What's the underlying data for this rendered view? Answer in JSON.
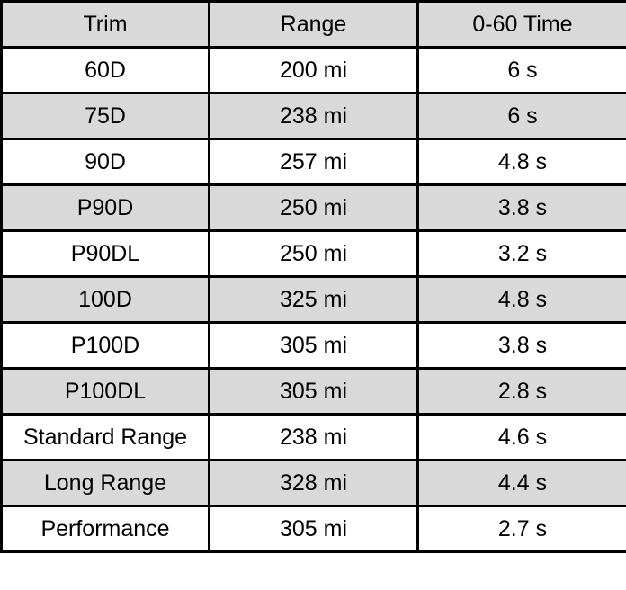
{
  "table": {
    "headers": [
      "Trim",
      "Range",
      "0-60 Time"
    ],
    "header_bg": "#d9d9d9",
    "shade_bg": "#d9d9d9",
    "rows": [
      {
        "trim": "60D",
        "range": "200 mi",
        "zero_to_sixty": "6 s",
        "shaded": false
      },
      {
        "trim": "75D",
        "range": "238 mi",
        "zero_to_sixty": "6 s",
        "shaded": true
      },
      {
        "trim": "90D",
        "range": "257 mi",
        "zero_to_sixty": "4.8 s",
        "shaded": false
      },
      {
        "trim": "P90D",
        "range": "250 mi",
        "zero_to_sixty": "3.8 s",
        "shaded": true
      },
      {
        "trim": "P90DL",
        "range": "250 mi",
        "zero_to_sixty": "3.2 s",
        "shaded": false
      },
      {
        "trim": "100D",
        "range": "325 mi",
        "zero_to_sixty": "4.8 s",
        "shaded": true
      },
      {
        "trim": "P100D",
        "range": "305 mi",
        "zero_to_sixty": "3.8 s",
        "shaded": false
      },
      {
        "trim": "P100DL",
        "range": "305 mi",
        "zero_to_sixty": "2.8 s",
        "shaded": true
      },
      {
        "trim": "Standard Range",
        "range": "238 mi",
        "zero_to_sixty": "4.6 s",
        "shaded": false
      },
      {
        "trim": "Long Range",
        "range": "328 mi",
        "zero_to_sixty": "4.4 s",
        "shaded": true
      },
      {
        "trim": "Performance",
        "range": "305 mi",
        "zero_to_sixty": "2.7 s",
        "shaded": false
      }
    ]
  }
}
